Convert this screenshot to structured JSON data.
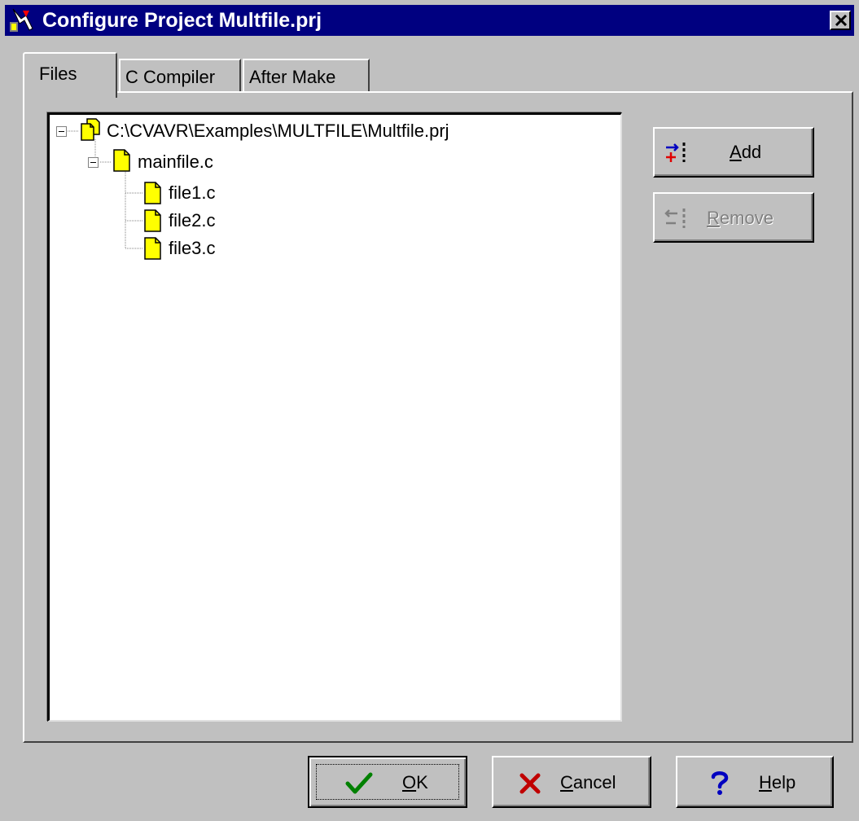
{
  "window": {
    "title": "Configure Project Multfile.prj"
  },
  "tabs": [
    {
      "label": "Files",
      "active": true
    },
    {
      "label": "C Compiler",
      "active": false
    },
    {
      "label": "After Make",
      "active": false
    }
  ],
  "tree": {
    "root": "C:\\CVAVR\\Examples\\MULTFILE\\Multfile.prj",
    "main_file": "mainfile.c",
    "children": [
      "file1.c",
      "file2.c",
      "file3.c"
    ]
  },
  "buttons": {
    "add": {
      "accel": "A",
      "rest": "dd"
    },
    "remove": {
      "accel": "R",
      "rest": "emove"
    },
    "ok": {
      "accel": "O",
      "rest": "K"
    },
    "cancel": {
      "accel": "C",
      "rest": "ancel"
    },
    "help": {
      "accel": "H",
      "rest": "elp"
    }
  },
  "colors": {
    "titlebar": "#000080",
    "face": "#c0c0c0",
    "file_icon": "#ffff00",
    "ok_check": "#008000",
    "cancel_x": "#c00000",
    "help_q": "#0000c0"
  }
}
